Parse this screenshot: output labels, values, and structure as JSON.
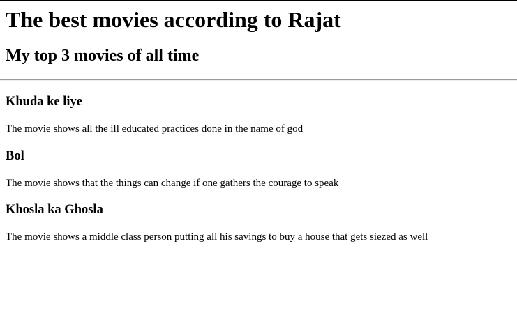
{
  "page": {
    "title": "The best movies according to Rajat",
    "subtitle": "My top 3 movies of all time"
  },
  "movies": [
    {
      "title": "Khuda ke liye",
      "description": "The movie shows all the ill educated practices done in the name of god"
    },
    {
      "title": "Bol",
      "description": "The movie shows that the things can change if one gathers the courage to speak"
    },
    {
      "title": "Khosla ka Ghosla",
      "description": "The movie shows a middle class person putting all his savings to buy a house that gets siezed as well"
    }
  ]
}
